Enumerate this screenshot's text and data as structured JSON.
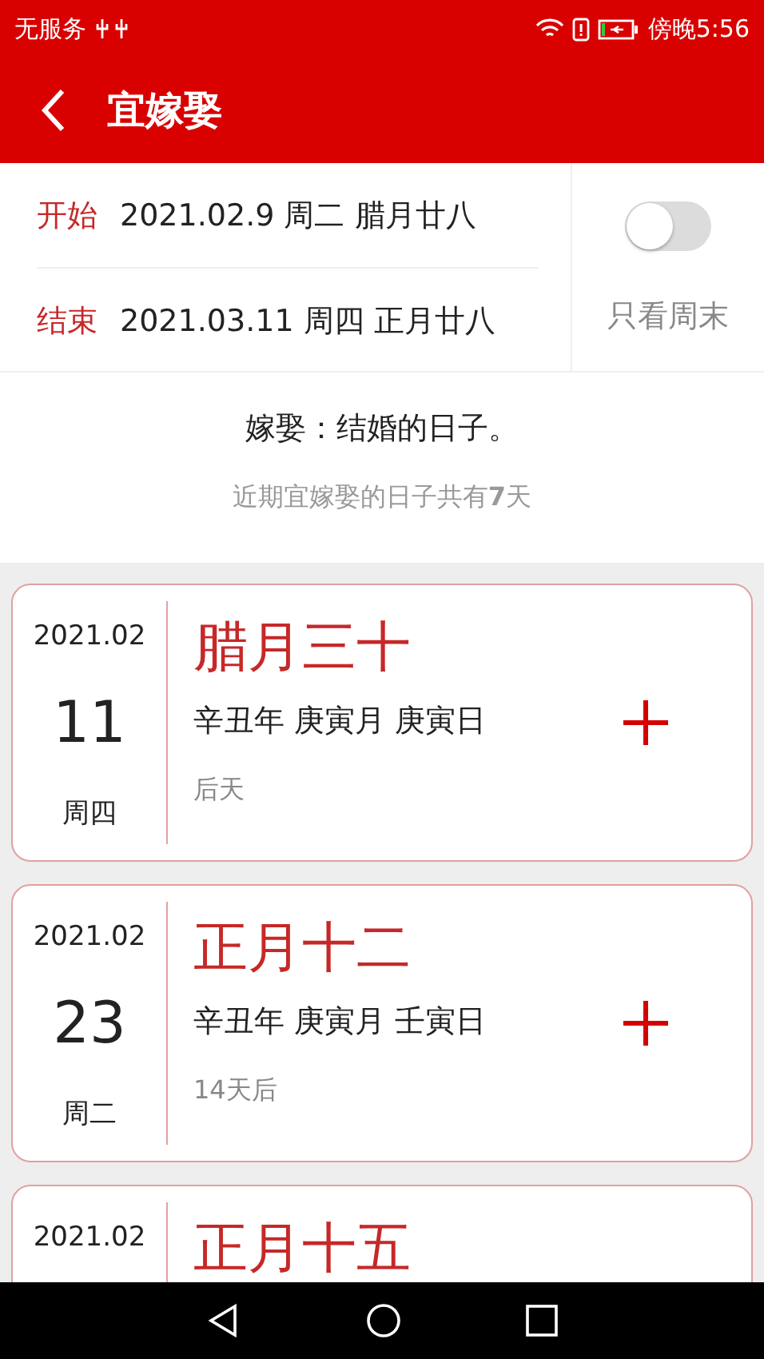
{
  "status_bar": {
    "carrier": "无服务",
    "time": "傍晚5:56"
  },
  "header": {
    "title": "宜嫁娶"
  },
  "range": {
    "rows": [
      {
        "label": "开始",
        "value": "2021.02.9 周二 腊月廿八"
      },
      {
        "label": "结束",
        "value": "2021.03.11 周四 正月廿八"
      }
    ],
    "weekend_only": {
      "label": "只看周末",
      "on": false
    }
  },
  "description": "嫁娶：结婚的日子。",
  "summary": "近期宜嫁娶的日子共有**7**天",
  "days": [
    {
      "month": "2021.02",
      "day": "11",
      "weekday": "周四",
      "lunar": "腊月三十",
      "ganzhi": "辛丑年 庚寅月 庚寅日",
      "relative": "后天"
    },
    {
      "month": "2021.02",
      "day": "23",
      "weekday": "周二",
      "lunar": "正月十二",
      "ganzhi": "辛丑年 庚寅月 壬寅日",
      "relative": "14天后"
    },
    {
      "month": "2021.02",
      "lunar": "正月十五"
    }
  ]
}
